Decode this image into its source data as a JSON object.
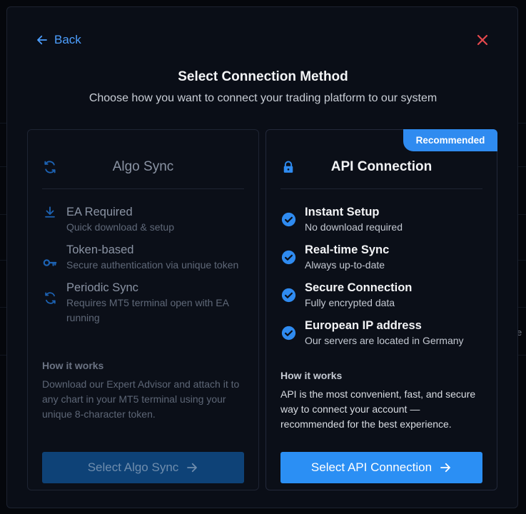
{
  "header": {
    "back_label": "Back",
    "title": "Select Connection Method",
    "subtitle": "Choose how you want to connect your trading platform to our system"
  },
  "background": {
    "edge_text": "e"
  },
  "algo": {
    "title": "Algo Sync",
    "features": [
      {
        "icon": "download-icon",
        "title": "EA Required",
        "desc": "Quick download & setup"
      },
      {
        "icon": "key-icon",
        "title": "Token-based",
        "desc": "Secure authentication via unique token"
      },
      {
        "icon": "sync-icon",
        "title": "Periodic Sync",
        "desc": "Requires MT5 terminal open with EA running"
      }
    ],
    "how_title": "How it works",
    "how_text": "Download our Expert Advisor and attach it to any chart in your MT5 terminal using your unique 8-character token.",
    "button_label": "Select Algo Sync"
  },
  "api": {
    "badge": "Recommended",
    "title": "API Connection",
    "features": [
      {
        "icon": "check-circle-icon",
        "title": "Instant Setup",
        "desc": "No download required"
      },
      {
        "icon": "check-circle-icon",
        "title": "Real-time Sync",
        "desc": "Always up-to-date"
      },
      {
        "icon": "check-circle-icon",
        "title": "Secure Connection",
        "desc": "Fully encrypted data"
      },
      {
        "icon": "check-circle-icon",
        "title": "European IP address",
        "desc": "Our servers are located in Germany"
      }
    ],
    "how_title": "How it works",
    "how_text": "API is the most convenient, fast, and secure way to connect your account — recommended for the best experience.",
    "button_label": "Select API Connection"
  },
  "colors": {
    "accent": "#2b8ff4",
    "close": "#e5484d",
    "muted_button": "#0e4277"
  }
}
